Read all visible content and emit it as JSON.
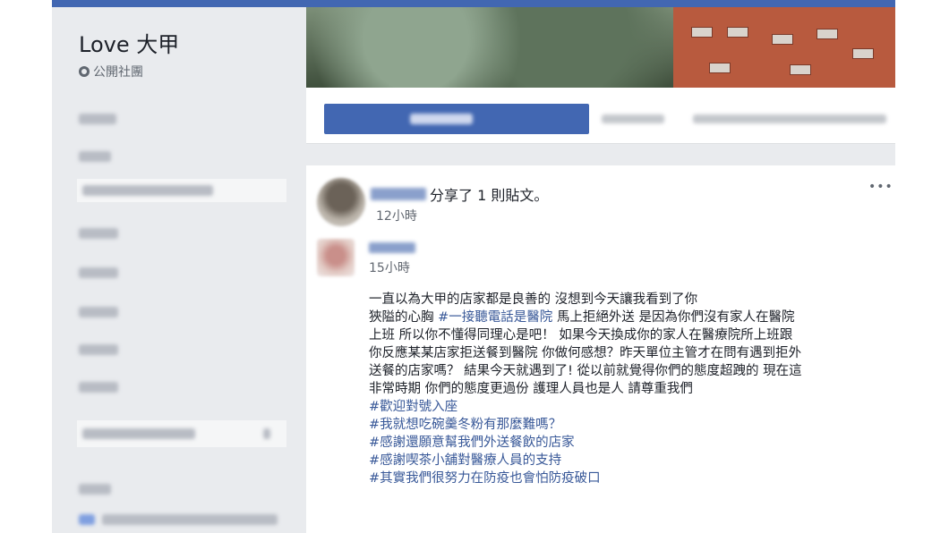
{
  "sidebar": {
    "group_name": "Love 大甲",
    "privacy": "公開社團",
    "privacy_icon": "globe-icon"
  },
  "post": {
    "share_action": "分享了 1 則貼文。",
    "share_time": "12小時",
    "original_time": "15小時",
    "more_icon": "•••",
    "body_lines": [
      {
        "parts": [
          {
            "text": "一直以為大甲的店家都是良善的 沒想到今天讓我看到了你",
            "tag": false
          }
        ]
      },
      {
        "parts": [
          {
            "text": "狹隘的心胸 ",
            "tag": false
          },
          {
            "text": "#一接聽電話是醫院",
            "tag": true
          },
          {
            "text": " 馬上拒絕外送 是因為你們沒有家人在醫院",
            "tag": false
          }
        ]
      },
      {
        "parts": [
          {
            "text": "上班 所以你不懂得同理心是吧！ 如果今天換成你的家人在醫療院所上班跟",
            "tag": false
          }
        ]
      },
      {
        "parts": [
          {
            "text": "你反應某某店家拒送餐到醫院 你做何感想？昨天單位主管才在問有遇到拒外",
            "tag": false
          }
        ]
      },
      {
        "parts": [
          {
            "text": "送餐的店家嗎？ 結果今天就遇到了! 從以前就覺得你們的態度超跩的 現在這",
            "tag": false
          }
        ]
      },
      {
        "parts": [
          {
            "text": "非常時期 你們的態度更過份 護理人員也是人 請尊重我們",
            "tag": false
          }
        ]
      },
      {
        "parts": [
          {
            "text": "#歡迎對號入座",
            "tag": true
          }
        ]
      },
      {
        "parts": [
          {
            "text": "#我就想吃碗羹冬粉有那麼難嗎？",
            "tag": true
          }
        ]
      },
      {
        "parts": [
          {
            "text": "#感謝還願意幫我們外送餐飲的店家",
            "tag": true
          }
        ]
      },
      {
        "parts": [
          {
            "text": "#感謝喫茶小舖對醫療人員的支持",
            "tag": true
          }
        ]
      },
      {
        "parts": [
          {
            "text": "#其實我們很努力在防疫也會怕防疫破口",
            "tag": true
          }
        ]
      }
    ]
  },
  "colors": {
    "brand": "#4267b2",
    "hashtag": "#385898",
    "sidebar_bg": "#e9ebee"
  }
}
